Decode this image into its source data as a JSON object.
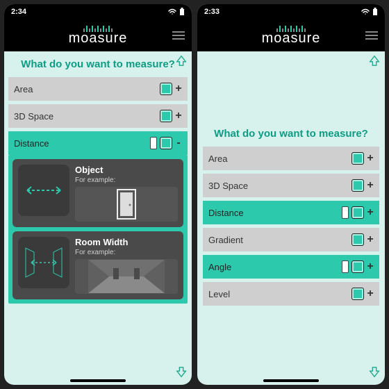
{
  "left": {
    "time": "2:34",
    "brand": "moasure",
    "heading": "What do you want to measure?",
    "rows": [
      {
        "label": "Area",
        "pill": false,
        "sign": "+",
        "active": false
      },
      {
        "label": "3D Space",
        "pill": false,
        "sign": "+",
        "active": false
      },
      {
        "label": "Distance",
        "pill": true,
        "sign": "-",
        "active": true
      }
    ],
    "cards": [
      {
        "title": "Object",
        "sub": "For example:",
        "icon": "door"
      },
      {
        "title": "Room Width",
        "sub": "For example:",
        "icon": "room"
      }
    ]
  },
  "right": {
    "time": "2:33",
    "brand": "moasure",
    "heading": "What do you want to measure?",
    "rows": [
      {
        "label": "Area",
        "pill": false,
        "sign": "+",
        "active": false
      },
      {
        "label": "3D Space",
        "pill": false,
        "sign": "+",
        "active": false
      },
      {
        "label": "Distance",
        "pill": true,
        "sign": "+",
        "active": true
      },
      {
        "label": "Gradient",
        "pill": false,
        "sign": "+",
        "active": false
      },
      {
        "label": "Angle",
        "pill": true,
        "sign": "+",
        "active": true
      },
      {
        "label": "Level",
        "pill": false,
        "sign": "+",
        "active": false
      }
    ]
  }
}
